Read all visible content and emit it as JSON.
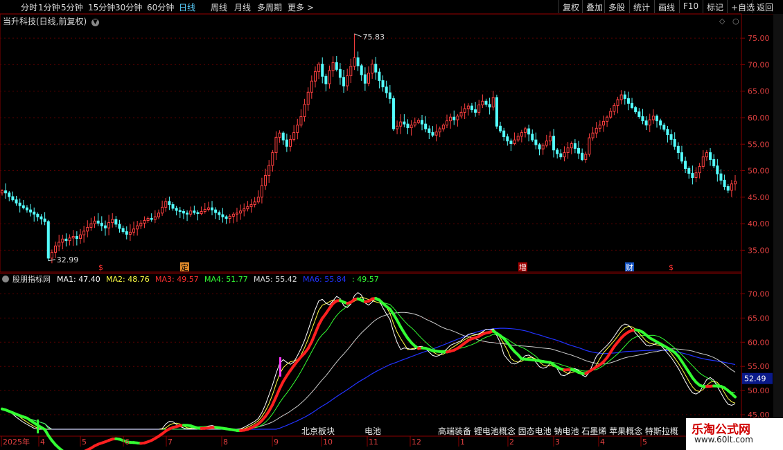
{
  "toolbar": {
    "periods": [
      "分时",
      "1分钟",
      "5分钟",
      "15分钟",
      "30分钟",
      "60分钟",
      "日线",
      "周线",
      "月线",
      "多周期",
      "更多 >"
    ],
    "active": "日线",
    "right_buttons": [
      "复权",
      "叠加",
      "多股",
      "统计",
      "画线",
      "F10",
      "标记",
      "+自选",
      "返回"
    ]
  },
  "stock_title": "当升科技(日线,前复权)",
  "indicator": {
    "name": "股朋指标网",
    "ma": [
      {
        "label": "MA1: 47.40",
        "color": "#ffffff"
      },
      {
        "label": "MA2: 48.76",
        "color": "#ffff44"
      },
      {
        "label": "MA3: 49.57",
        "color": "#ff3030"
      },
      {
        "label": "MA4: 51.77",
        "color": "#33ff33"
      },
      {
        "label": "MA5: 55.42",
        "color": "#dddddd"
      },
      {
        "label": "MA6: 55.84",
        "color": "#2233ff"
      },
      {
        "label": ": 49.57",
        "color": "#33ff33"
      }
    ],
    "current_value": "52.49"
  },
  "event_markers": [
    {
      "label": "$",
      "x": 147,
      "color": "#ff3030",
      "bg": "#000"
    },
    {
      "label": "定",
      "x": 266,
      "color": "#000",
      "bg": "#e08a2a"
    },
    {
      "label": "增",
      "x": 754,
      "color": "#fff",
      "bg": "#a00000"
    },
    {
      "label": "财",
      "x": 908,
      "color": "#fff",
      "bg": "#1050c0"
    },
    {
      "label": "$",
      "x": 970,
      "color": "#ff3030",
      "bg": "#000"
    }
  ],
  "sector_labels": [
    {
      "text": "北京板块",
      "x": 435
    },
    {
      "text": "电池",
      "x": 526
    },
    {
      "text": "高端装备 锂电池概念 固态电池 钠电池 石墨烯 苹果概念 特斯拉概",
      "x": 632
    }
  ],
  "date_axis": [
    "2025年",
    "4",
    "5",
    "6",
    "7",
    "8",
    "9",
    "10",
    "11",
    "12",
    "1",
    "2",
    "3",
    "4",
    "5"
  ],
  "watermark": {
    "title": "乐淘公式网",
    "url": "www.60lt.com"
  },
  "chart_data": [
    {
      "type": "candlestick",
      "title": "当升科技(日线,前复权)",
      "y_ticks": [
        35.0,
        40.0,
        45.0,
        50.0,
        55.0,
        60.0,
        65.0,
        70.0,
        75.0
      ],
      "ylim": [
        31.0,
        77.5
      ],
      "annotations": [
        {
          "text": "75.83",
          "value": 75.83
        },
        {
          "text": "32.99",
          "value": 32.99
        }
      ],
      "close": [
        46.2,
        45.8,
        45.1,
        44.5,
        43.9,
        43.4,
        43.0,
        42.6,
        42.2,
        41.8,
        41.3,
        40.9,
        40.4,
        33.5,
        34.6,
        35.8,
        36.5,
        37.1,
        36.8,
        37.3,
        37.6,
        37.2,
        37.9,
        38.6,
        39.3,
        40.0,
        40.5,
        40.1,
        39.6,
        39.2,
        40.2,
        40.8,
        39.9,
        39.1,
        38.5,
        38.0,
        38.4,
        39.0,
        39.6,
        40.1,
        40.6,
        41.0,
        40.8,
        41.3,
        42.0,
        43.1,
        44.2,
        43.6,
        42.9,
        42.5,
        42.3,
        42.0,
        41.8,
        42.4,
        42.1,
        41.9,
        42.3,
        42.7,
        43.0,
        42.6,
        42.1,
        41.7,
        41.3,
        41.0,
        41.4,
        41.8,
        42.0,
        42.4,
        42.8,
        43.2,
        43.6,
        44.1,
        45.0,
        47.2,
        49.1,
        51.0,
        53.4,
        56.3,
        57.1,
        55.8,
        54.6,
        55.9,
        57.2,
        58.6,
        60.2,
        62.5,
        64.8,
        66.9,
        68.7,
        70.1,
        67.8,
        66.4,
        68.9,
        70.4,
        69.1,
        67.6,
        66.0,
        67.9,
        69.7,
        71.3,
        69.8,
        68.1,
        66.5,
        68.4,
        70.1,
        68.6,
        67.0,
        65.8,
        64.7,
        63.6,
        57.9,
        58.4,
        59.2,
        58.8,
        58.1,
        58.6,
        59.1,
        59.5,
        58.8,
        57.9,
        57.2,
        56.7,
        57.3,
        57.9,
        58.6,
        59.4,
        60.1,
        59.6,
        60.3,
        61.0,
        61.7,
        62.2,
        61.5,
        61.0,
        62.4,
        63.1,
        62.5,
        62.0,
        63.8,
        58.4,
        57.5,
        56.4,
        55.6,
        55.1,
        55.8,
        56.5,
        57.2,
        57.9,
        56.9,
        55.8,
        54.9,
        54.1,
        54.8,
        55.6,
        56.5,
        53.9,
        53.2,
        52.6,
        53.4,
        54.3,
        55.1,
        54.2,
        53.3,
        52.1,
        53.1,
        56.2,
        57.1,
        58.0,
        58.6,
        59.3,
        60.1,
        61.2,
        62.3,
        63.4,
        64.3,
        63.6,
        62.7,
        61.9,
        61.1,
        60.2,
        59.4,
        58.6,
        59.6,
        60.3,
        59.4,
        58.6,
        57.8,
        56.8,
        55.9,
        54.6,
        53.4,
        51.8,
        50.4,
        49.5,
        48.7,
        49.6,
        50.8,
        52.6,
        53.4,
        52.1,
        50.9,
        49.4,
        48.2,
        47.0,
        46.3,
        47.5,
        48.0
      ]
    },
    {
      "type": "line",
      "title": "股朋指标网",
      "y_ticks": [
        45.0,
        50.0,
        55.0,
        60.0,
        65.0,
        70.0
      ],
      "ylim": [
        42.0,
        73.5
      ],
      "series": [
        {
          "name": "MA1",
          "color": "#ffffff"
        },
        {
          "name": "MA2",
          "color": "#ffff44"
        },
        {
          "name": "MA3",
          "color": "#ff3030"
        },
        {
          "name": "MA4",
          "color": "#33ff33"
        },
        {
          "name": "MA5",
          "color": "#dddddd"
        },
        {
          "name": "MA6",
          "color": "#2233ff"
        }
      ]
    }
  ]
}
